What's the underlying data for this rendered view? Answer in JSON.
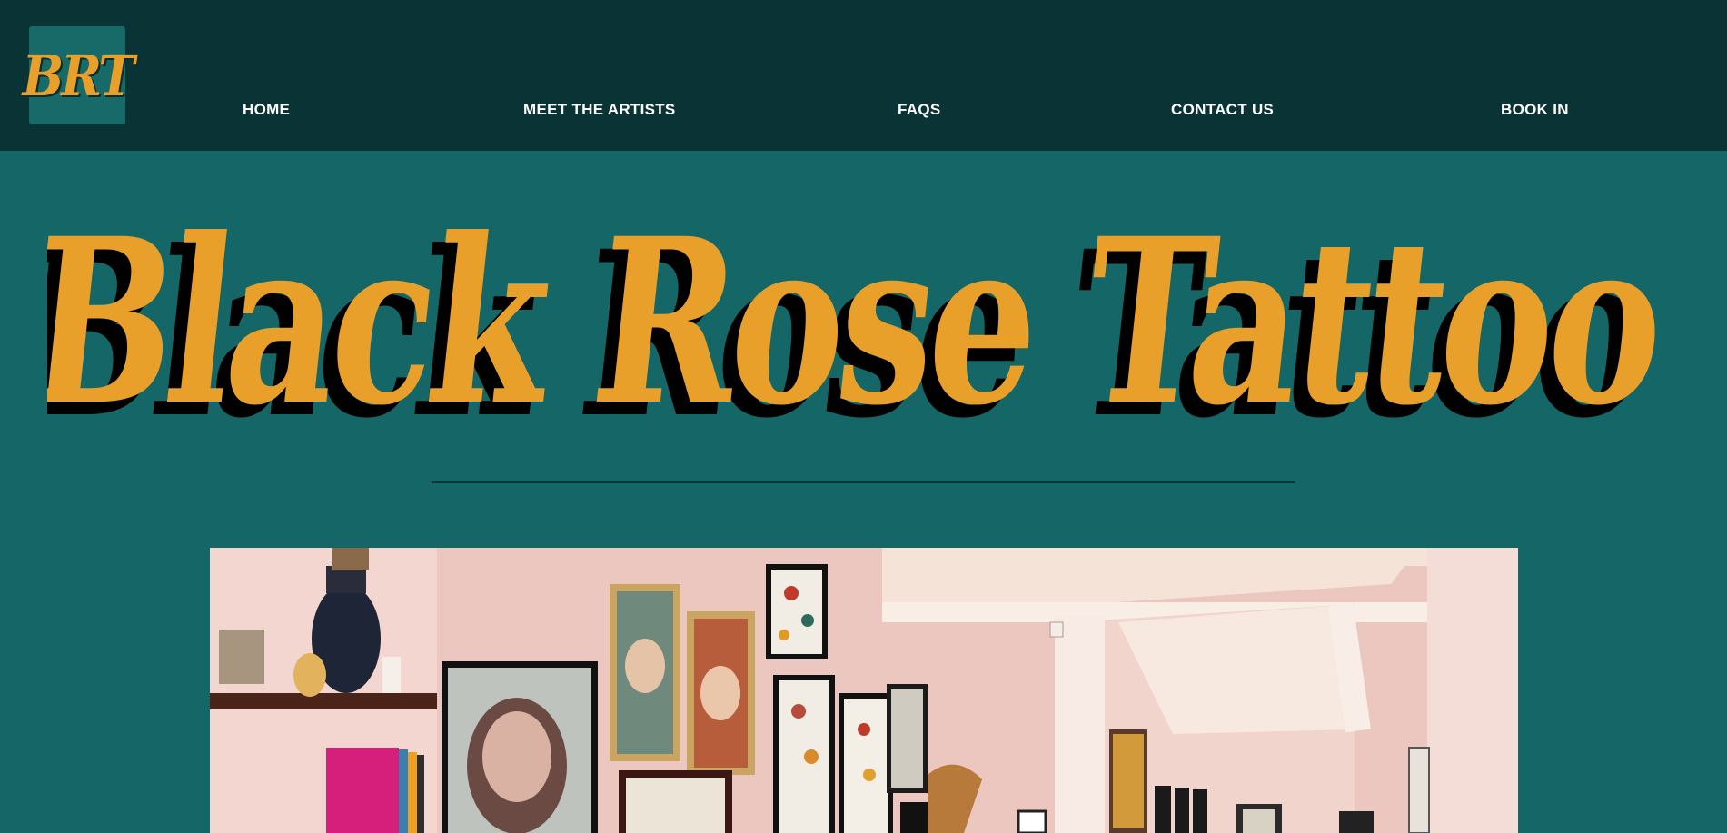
{
  "header": {
    "logo_text": "BRT",
    "nav": [
      {
        "label": "HOME"
      },
      {
        "label": "MEET THE ARTISTS"
      },
      {
        "label": "FAQS"
      },
      {
        "label": "CONTACT US"
      },
      {
        "label": "BOOK IN"
      }
    ]
  },
  "hero": {
    "title": "Black Rose Tattoo"
  },
  "colors": {
    "header_bg": "#093335",
    "page_bg": "#156666",
    "accent": "#e9a02b",
    "shadow": "#000000",
    "nav_text": "#ffffff"
  }
}
